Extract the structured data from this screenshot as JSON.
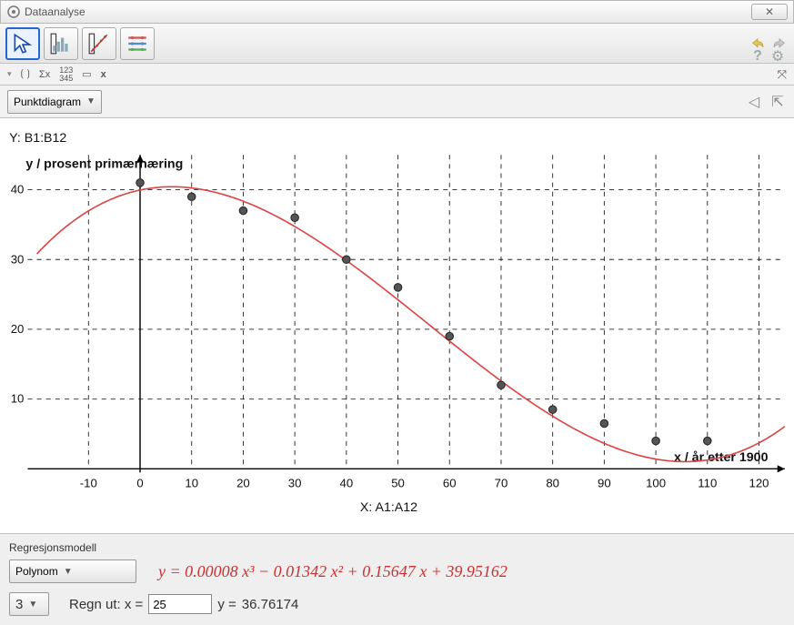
{
  "window": {
    "title": "Dataanalyse"
  },
  "toolbar2": {
    "sigma": "Σx",
    "frac": "123\n345",
    "x": "x"
  },
  "dropdown": {
    "chartType": "Punktdiagram"
  },
  "axes": {
    "y_range_label": "Y:  B1:B12",
    "x_range_label": "X:  A1:A12",
    "y_title": "y / prosent primærnæring",
    "x_title": "x / år etter 1900"
  },
  "regression": {
    "panel_label": "Regresjonsmodell",
    "model": "Polynom",
    "degree": "3",
    "equation_html": "y = 0.00008 x³ − 0.01342 x² + 0.15647 x + 39.95162",
    "calc_label": "Regn ut:  x =",
    "calc_x": "25",
    "calc_y_label": "y =",
    "calc_y_value": "36.76174"
  },
  "chart_data": {
    "type": "scatter",
    "title": "",
    "xlabel": "x / år etter 1900",
    "ylabel": "y / prosent primærnæring",
    "xlim": [
      -20,
      125
    ],
    "ylim": [
      0,
      45
    ],
    "xticks": [
      -10,
      0,
      10,
      20,
      30,
      40,
      50,
      60,
      70,
      80,
      90,
      100,
      110,
      120
    ],
    "yticks": [
      10,
      20,
      30,
      40
    ],
    "series": [
      {
        "name": "data",
        "type": "scatter",
        "x": [
          0,
          10,
          20,
          30,
          40,
          50,
          60,
          70,
          80,
          90,
          100,
          110
        ],
        "y": [
          41,
          39,
          37,
          36,
          30,
          26,
          19,
          12,
          8.5,
          6.5,
          4,
          4
        ]
      },
      {
        "name": "fit",
        "type": "line",
        "coeffs": [
          8e-05,
          -0.01342,
          0.15647,
          39.95162
        ]
      }
    ]
  }
}
